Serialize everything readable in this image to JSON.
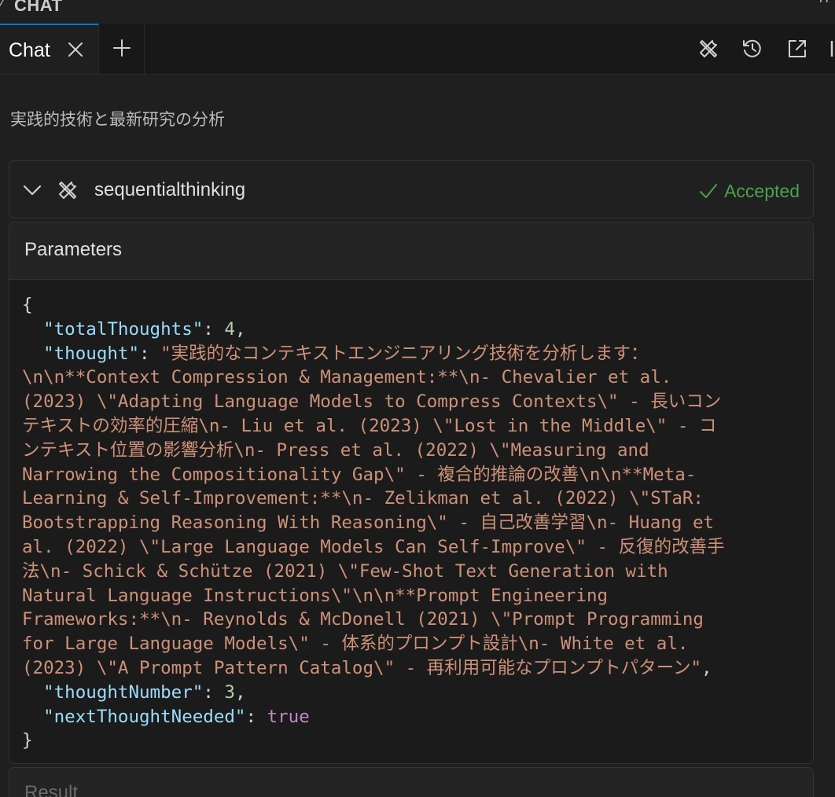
{
  "panel": {
    "title": "CHAT",
    "more": "··"
  },
  "tabs": {
    "chat_label": "Chat"
  },
  "conversation": {
    "subtitle": "実践的技術と最新研究の分析"
  },
  "tool_call": {
    "name": "sequentialthinking",
    "status": "Accepted",
    "status_color": "#4aa34a"
  },
  "parameters": {
    "title": "Parameters",
    "open_brace": "{",
    "close_brace": "}",
    "totalThoughts_key": "\"totalThoughts\"",
    "totalThoughts_value": "4",
    "thought_key": "\"thought\"",
    "thought_lines": [
      "\"実践的なコンテキストエンジニアリング技術を分析します：",
      "\\n\\n**Context Compression & Management:**\\n- Chevalier et al.",
      "(2023) \\\"Adapting Language Models to Compress Contexts\\\" - 長いコン",
      "テキストの効率的圧縮\\n- Liu et al. (2023) \\\"Lost in the Middle\\\" - コ",
      "ンテキスト位置の影響分析\\n- Press et al. (2022) \\\"Measuring and",
      "Narrowing the Compositionality Gap\\\" - 複合的推論の改善\\n\\n**Meta-",
      "Learning & Self-Improvement:**\\n- Zelikman et al. (2022) \\\"STaR:",
      "Bootstrapping Reasoning With Reasoning\\\" - 自己改善学習\\n- Huang et",
      "al. (2022) \\\"Large Language Models Can Self-Improve\\\" - 反復的改善手",
      "法\\n- Schick & Schütze (2021) \\\"Few-Shot Text Generation with",
      "Natural Language Instructions\\\"\\n\\n**Prompt Engineering",
      "Frameworks:**\\n- Reynolds & McDonell (2021) \\\"Prompt Programming",
      "for Large Language Models\\\" - 体系的プロンプト設計\\n- White et al.",
      "(2023) \\\"A Prompt Pattern Catalog\\\" - 再利用可能なプロンプトパターン\""
    ],
    "thoughtNumber_key": "\"thoughtNumber\"",
    "thoughtNumber_value": "3",
    "nextThoughtNeeded_key": "\"nextThoughtNeeded\"",
    "nextThoughtNeeded_value": "true"
  },
  "result": {
    "title": "Result"
  },
  "icons": {
    "tools": "tools-icon",
    "history": "history-icon",
    "open_in_editor": "open-in-editor-icon",
    "chevron": "chevron-down-icon",
    "check": "check-icon",
    "close": "close-icon",
    "plus": "plus-icon"
  }
}
